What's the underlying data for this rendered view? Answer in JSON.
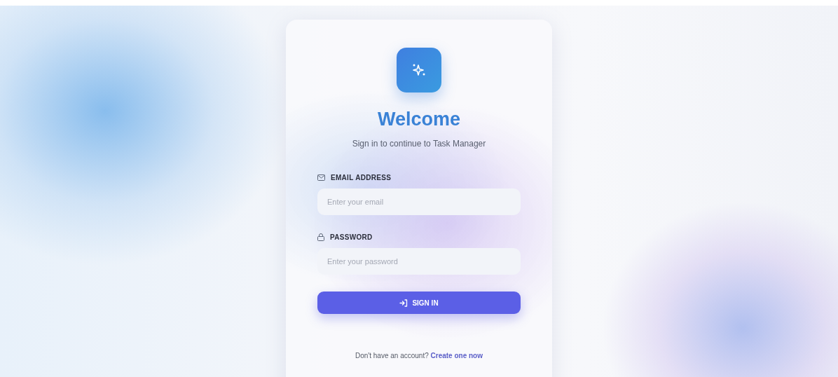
{
  "brand": {
    "title": "Welcome",
    "subtitle": "Sign in to continue to Task Manager"
  },
  "fields": [
    {
      "kind": "email",
      "label": "EMAIL ADDRESS",
      "placeholder": "Enter your email"
    },
    {
      "kind": "password",
      "label": "PASSWORD",
      "placeholder": "Enter your password"
    }
  ],
  "submit": {
    "label": "SIGN IN"
  },
  "footer": {
    "text": "Don't have an account?",
    "link": "Create one now"
  }
}
